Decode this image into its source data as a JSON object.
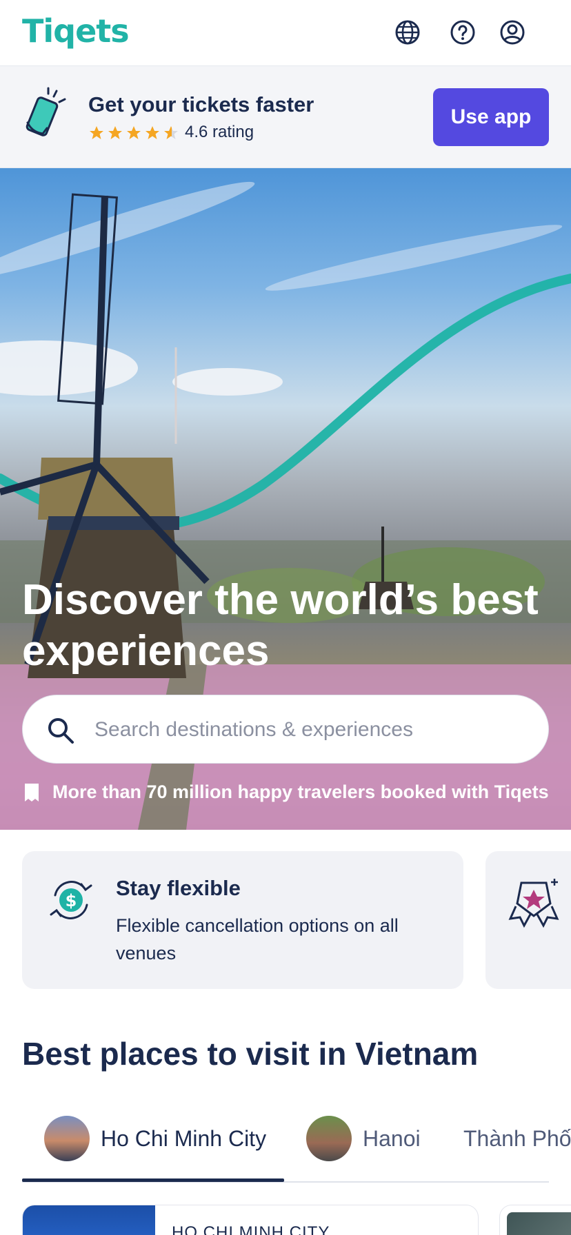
{
  "header": {
    "logo": "Tiqets",
    "icons": [
      "globe-icon",
      "help-icon",
      "account-icon"
    ]
  },
  "app_banner": {
    "title": "Get your tickets faster",
    "rating": 4.6,
    "rating_text": "4.6 rating",
    "button_label": "Use app"
  },
  "hero": {
    "title": "Discover the world’s best experiences",
    "search": {
      "placeholder": "Search destinations & experiences",
      "value": ""
    },
    "travelers_text": "More than 70 million happy travelers booked with Tiqets"
  },
  "usp_cards": [
    {
      "title": "Stay flexible",
      "text": "Flexible cancellation options on all venues",
      "icon": "dollar-refresh-icon"
    },
    {
      "title": "",
      "text": "",
      "icon": "award-star-icon"
    }
  ],
  "best_places": {
    "title": "Best places to visit in Vietnam",
    "tabs": [
      {
        "label": "Ho Chi Minh City",
        "active": true
      },
      {
        "label": "Hanoi",
        "active": false
      },
      {
        "label": "Thành Phố",
        "active": false
      }
    ]
  },
  "card": {
    "city": "HO CHI MINH CITY"
  },
  "colors": {
    "brand": "#21b3a7",
    "accent": "#5449e0",
    "text": "#1b2a4e",
    "star": "#f5a623"
  }
}
